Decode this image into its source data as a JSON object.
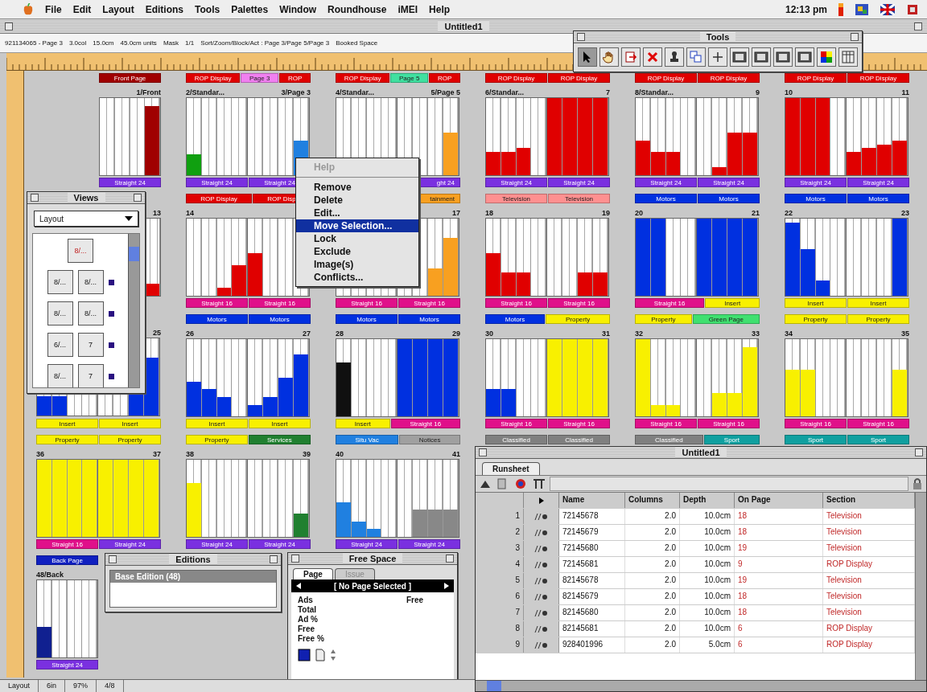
{
  "menubar": {
    "items": [
      "File",
      "Edit",
      "Layout",
      "Editions",
      "Tools",
      "Palettes",
      "Window",
      "Roundhouse",
      "iMEI",
      "Help"
    ],
    "clock": "12:13 pm"
  },
  "document": {
    "title": "Untitled1",
    "info": [
      "921134065 - Page 3",
      "3.0col",
      "15.0cm",
      "45.0cm units",
      "Mask",
      "1/1",
      "Sort/Zoom/Block/Act : Page 3/Page 5/Page 3",
      "Booked Space"
    ]
  },
  "tools": {
    "title": "Tools",
    "items": [
      {
        "kind": "pointer",
        "selected": true
      },
      {
        "kind": "hand",
        "selected": false
      },
      {
        "kind": "import",
        "selected": false
      },
      {
        "kind": "delete",
        "selected": false
      },
      {
        "kind": "stamp",
        "selected": false
      },
      {
        "kind": "columns",
        "selected": false
      },
      {
        "kind": "crosshair",
        "selected": false
      },
      {
        "kind": "panel",
        "selected": false
      },
      {
        "kind": "panel",
        "selected": false
      },
      {
        "kind": "panel",
        "selected": false
      },
      {
        "kind": "panel",
        "selected": false
      },
      {
        "kind": "palette",
        "selected": false
      },
      {
        "kind": "grid",
        "selected": false
      }
    ]
  },
  "rows": [
    {
      "spreads": [
        {
          "kind": "single_right",
          "section": [
            {
              "text": "Front Page",
              "color": "#a00000"
            }
          ],
          "right_label": "1/Front",
          "pages": [
            {
              "color": "#a00000",
              "cols": [
                {
                  "level": 0
                },
                {
                  "level": 0
                },
                {
                  "level": 0
                },
                {
                  "level": 0.9
                }
              ]
            }
          ],
          "template": [
            {
              "text": "Straight 24",
              "color": "#7a30e0"
            }
          ]
        },
        {
          "kind": "spread",
          "section": [
            {
              "text": "ROP Display",
              "color": "#e00000"
            },
            {
              "text": "Page 3",
              "color": "#f080f0"
            },
            {
              "text": "ROP",
              "color": "#e00000"
            }
          ],
          "left_label": "2/Standar...",
          "right_label": "3/Page 3",
          "pages": [
            {
              "color": "#10a010",
              "cols": [
                {
                  "level": 0.27
                },
                {
                  "level": 0
                },
                {
                  "level": 0
                },
                {
                  "level": 0
                }
              ]
            },
            {
              "color": "#2080e0",
              "cols": [
                {
                  "level": 0
                },
                {
                  "level": 0
                },
                {
                  "level": 0
                },
                {
                  "level": 0.45
                }
              ]
            }
          ],
          "template": [
            {
              "text": "Straight 24",
              "color": "#7a30e0"
            },
            {
              "text": "Straight 24",
              "color": "#7a30e0"
            }
          ]
        },
        {
          "kind": "spread",
          "section": [
            {
              "text": "ROP Display",
              "color": "#e00000"
            },
            {
              "text": "Page 5",
              "color": "#40e0a0"
            },
            {
              "text": "ROP",
              "color": "#e00000"
            }
          ],
          "left_label": "4/Standar...",
          "right_label": "5/Page 5",
          "pages": [
            {
              "cols": [
                {
                  "level": 0
                },
                {
                  "level": 0
                },
                {
                  "level": 0
                },
                {
                  "level": 0
                }
              ]
            },
            {
              "color": "#f8a020",
              "cols": [
                {
                  "level": 0
                },
                {
                  "level": 0
                },
                {
                  "level": 0
                },
                {
                  "level": 0.55
                }
              ]
            }
          ],
          "template": [
            {
              "text": "ght 24",
              "color": "#7a30e0"
            }
          ]
        },
        {
          "kind": "spread",
          "section": [
            {
              "text": "ROP Display",
              "color": "#e00000"
            },
            {
              "text": "ROP Display",
              "color": "#e00000"
            }
          ],
          "left_label": "6/Standar...",
          "right_label": "7",
          "pages": [
            {
              "color": "#e00000",
              "cols": [
                {
                  "level": 0.3
                },
                {
                  "level": 0.3
                },
                {
                  "level": 0.35
                },
                {
                  "level": 0
                }
              ]
            },
            {
              "color": "#e00000",
              "cols": [
                {
                  "level": 1
                },
                {
                  "level": 1
                },
                {
                  "level": 1
                },
                {
                  "level": 1
                }
              ]
            }
          ],
          "template": [
            {
              "text": "Straight 24",
              "color": "#7a30e0"
            },
            {
              "text": "Straight 24",
              "color": "#7a30e0"
            }
          ]
        },
        {
          "kind": "spread",
          "section": [
            {
              "text": "ROP Display",
              "color": "#e00000"
            },
            {
              "text": "ROP Display",
              "color": "#e00000"
            }
          ],
          "left_label": "8/Standar...",
          "right_label": "9",
          "pages": [
            {
              "color": "#e00000",
              "cols": [
                {
                  "level": 0.45
                },
                {
                  "level": 0.3
                },
                {
                  "level": 0.3
                },
                {
                  "level": 0
                }
              ]
            },
            {
              "color": "#e00000",
              "cols": [
                {
                  "level": 0
                },
                {
                  "level": 0.1
                },
                {
                  "level": 0.55
                },
                {
                  "level": 0.55
                }
              ]
            }
          ],
          "template": [
            {
              "text": "Straight 24",
              "color": "#7a30e0"
            },
            {
              "text": "Straight 24",
              "color": "#7a30e0"
            }
          ]
        },
        {
          "kind": "spread",
          "section": [
            {
              "text": "ROP Display",
              "color": "#e00000"
            },
            {
              "text": "ROP Display",
              "color": "#e00000"
            }
          ],
          "left_label": "10",
          "right_label": "11",
          "pages": [
            {
              "color": "#e00000",
              "cols": [
                {
                  "level": 1
                },
                {
                  "level": 1
                },
                {
                  "level": 1
                },
                {
                  "level": 0
                }
              ]
            },
            {
              "color": "#e00000",
              "cols": [
                {
                  "level": 0.3
                },
                {
                  "level": 0.35
                },
                {
                  "level": 0.4
                },
                {
                  "level": 0.45
                }
              ]
            }
          ],
          "template": [
            {
              "text": "Straight 24",
              "color": "#7a30e0"
            },
            {
              "text": "Straight 24",
              "color": "#7a30e0"
            }
          ]
        }
      ]
    },
    {
      "spreads": [
        {
          "kind": "single_right",
          "right_label": "13",
          "pages": [
            {
              "color": "#e00000",
              "cols": [
                {
                  "level": 0.15
                }
              ]
            }
          ]
        },
        {
          "kind": "spread",
          "section": [
            {
              "text": "ROP Display",
              "color": "#e00000"
            },
            {
              "text": "ROP Disp",
              "color": "#e00000"
            }
          ],
          "left_label": "14",
          "pages": [
            {
              "color": "#e00000",
              "cols": [
                {
                  "level": 0
                },
                {
                  "level": 0
                },
                {
                  "level": 0.1
                },
                {
                  "level": 0.4
                }
              ]
            },
            {
              "color": "#e00000",
              "cols": [
                {
                  "level": 0.55
                },
                {
                  "level": 0
                },
                {
                  "level": 0
                },
                {
                  "level": 0
                }
              ]
            }
          ],
          "template": [
            {
              "text": "Straight 16",
              "color": "#e0108a"
            },
            {
              "text": "Straight 16",
              "color": "#e0108a"
            }
          ]
        },
        {
          "kind": "spread",
          "section": [
            {
              "text": "tainment",
              "color": "#f8a020"
            }
          ],
          "right_label": "17",
          "pages": [
            {
              "cols": [
                {
                  "level": 0
                },
                {
                  "level": 0
                },
                {
                  "level": 0
                },
                {
                  "level": 0
                }
              ]
            },
            {
              "color": "#f8a020",
              "cols": [
                {
                  "level": 0
                },
                {
                  "level": 0
                },
                {
                  "level": 0.35
                },
                {
                  "level": 0.75
                }
              ]
            }
          ],
          "template": [
            {
              "text": "Straight 16",
              "color": "#e0108a"
            },
            {
              "text": "Straight 16",
              "color": "#e0108a"
            }
          ]
        },
        {
          "kind": "spread",
          "section": [
            {
              "text": "Television",
              "color": "#ff9090"
            },
            {
              "text": "Television",
              "color": "#ff9090"
            }
          ],
          "left_label": "18",
          "right_label": "19",
          "pages": [
            {
              "color": "#e00000",
              "cols": [
                {
                  "level": 0.55
                },
                {
                  "level": 0.3
                },
                {
                  "level": 0.3
                },
                {
                  "level": 0
                }
              ]
            },
            {
              "color": "#e00000",
              "cols": [
                {
                  "level": 0
                },
                {
                  "level": 0
                },
                {
                  "level": 0.3
                },
                {
                  "level": 0.3
                }
              ]
            }
          ],
          "template": [
            {
              "text": "Straight 16",
              "color": "#e0108a"
            },
            {
              "text": "Straight 16",
              "color": "#e0108a"
            }
          ]
        },
        {
          "kind": "spread",
          "section": [
            {
              "text": "Motors",
              "color": "#0030e0"
            },
            {
              "text": "Motors",
              "color": "#0030e0"
            }
          ],
          "left_label": "20",
          "right_label": "21",
          "pages": [
            {
              "color": "#0030e0",
              "cols": [
                {
                  "level": 1
                },
                {
                  "level": 1
                },
                {
                  "level": 0
                },
                {
                  "level": 0
                }
              ]
            },
            {
              "color": "#0030e0",
              "cols": [
                {
                  "level": 1
                },
                {
                  "level": 1
                },
                {
                  "level": 1
                },
                {
                  "level": 1
                }
              ]
            }
          ],
          "template": [
            {
              "text": "Straight 16",
              "color": "#e0108a"
            },
            {
              "text": "Insert",
              "color": "#f8f000"
            }
          ]
        },
        {
          "kind": "spread",
          "section": [
            {
              "text": "Motors",
              "color": "#0030e0"
            },
            {
              "text": "Motors",
              "color": "#0030e0"
            }
          ],
          "left_label": "22",
          "right_label": "23",
          "pages": [
            {
              "color": "#0030e0",
              "cols": [
                {
                  "level": 0.95
                },
                {
                  "level": 0.6
                },
                {
                  "level": 0.2
                },
                {
                  "level": 0
                }
              ]
            },
            {
              "color": "#0030e0",
              "cols": [
                {
                  "level": 0
                },
                {
                  "level": 0
                },
                {
                  "level": 0
                },
                {
                  "level": 1
                }
              ]
            }
          ],
          "template": [
            {
              "text": "Insert",
              "color": "#f8f000"
            },
            {
              "text": "Insert",
              "color": "#f8f000"
            }
          ]
        }
      ]
    },
    {
      "spreads": [
        {
          "kind": "spread",
          "right_label": "25",
          "pages": [
            {
              "color": "#0030e0",
              "cols": [
                {
                  "level": 0.25
                },
                {
                  "level": 0.25
                },
                {
                  "level": 0
                },
                {
                  "level": 0
                }
              ]
            },
            {
              "color": "#0030e0",
              "cols": [
                {
                  "level": 0
                },
                {
                  "level": 0
                },
                {
                  "level": 0.75
                },
                {
                  "level": 0.75
                }
              ]
            }
          ],
          "template": [
            {
              "text": "Insert",
              "color": "#f8f000"
            },
            {
              "text": "Insert",
              "color": "#f8f000"
            }
          ]
        },
        {
          "kind": "spread",
          "section": [
            {
              "text": "Motors",
              "color": "#0030e0"
            },
            {
              "text": "Motors",
              "color": "#0030e0"
            }
          ],
          "left_label": "26",
          "right_label": "27",
          "pages": [
            {
              "color": "#0030e0",
              "cols": [
                {
                  "level": 0.45
                },
                {
                  "level": 0.35
                },
                {
                  "level": 0.25
                },
                {
                  "level": 0
                }
              ]
            },
            {
              "color": "#0030e0",
              "cols": [
                {
                  "level": 0.15
                },
                {
                  "level": 0.25
                },
                {
                  "level": 0.5
                },
                {
                  "level": 0.8
                }
              ]
            }
          ],
          "template": [
            {
              "text": "Insert",
              "color": "#f8f000"
            },
            {
              "text": "Insert",
              "color": "#f8f000"
            }
          ]
        },
        {
          "kind": "spread",
          "section": [
            {
              "text": "Motors",
              "color": "#0030e0"
            },
            {
              "text": "Motors",
              "color": "#0030e0"
            }
          ],
          "left_label": "28",
          "right_label": "29",
          "pages": [
            {
              "color": "#101010",
              "cols": [
                {
                  "level": 0.7
                },
                {
                  "level": 0
                },
                {
                  "level": 0
                },
                {
                  "level": 0
                }
              ]
            },
            {
              "color": "#0030e0",
              "cols": [
                {
                  "level": 1
                },
                {
                  "level": 1
                },
                {
                  "level": 1
                },
                {
                  "level": 1
                }
              ]
            }
          ],
          "template": [
            {
              "text": "Insert",
              "color": "#f8f000"
            },
            {
              "text": "Straight 16",
              "color": "#e0108a"
            }
          ]
        },
        {
          "kind": "spread",
          "section": [
            {
              "text": "Motors",
              "color": "#0030e0"
            },
            {
              "text": "Property",
              "color": "#f8f000"
            }
          ],
          "left_label": "30",
          "right_label": "31",
          "pages": [
            {
              "color": "#0030e0",
              "cols": [
                {
                  "level": 0.35
                },
                {
                  "level": 0.35
                },
                {
                  "level": 0
                },
                {
                  "level": 0
                }
              ]
            },
            {
              "color": "#f8f000",
              "cols": [
                {
                  "level": 1
                },
                {
                  "level": 1
                },
                {
                  "level": 1
                },
                {
                  "level": 1
                }
              ]
            }
          ],
          "template": [
            {
              "text": "Straight 16",
              "color": "#e0108a"
            },
            {
              "text": "Straight 16",
              "color": "#e0108a"
            }
          ]
        },
        {
          "kind": "spread",
          "section": [
            {
              "text": "Property",
              "color": "#f8f000"
            },
            {
              "text": "Green Page",
              "color": "#40e070"
            }
          ],
          "left_label": "32",
          "right_label": "33",
          "pages": [
            {
              "color": "#f8f000",
              "cols": [
                {
                  "level": 1
                },
                {
                  "level": 0.15
                },
                {
                  "level": 0.15
                },
                {
                  "level": 0
                }
              ]
            },
            {
              "color": "#f8f000",
              "cols": [
                {
                  "level": 0
                },
                {
                  "level": 0.3
                },
                {
                  "level": 0.3
                },
                {
                  "level": 0.9
                }
              ]
            }
          ],
          "template": [
            {
              "text": "Straight 16",
              "color": "#e0108a"
            },
            {
              "text": "Straight 16",
              "color": "#e0108a"
            }
          ]
        },
        {
          "kind": "spread",
          "section": [
            {
              "text": "Property",
              "color": "#f8f000"
            },
            {
              "text": "Property",
              "color": "#f8f000"
            }
          ],
          "left_label": "34",
          "right_label": "35",
          "pages": [
            {
              "color": "#f8f000",
              "cols": [
                {
                  "level": 0.6
                },
                {
                  "level": 0.6
                },
                {
                  "level": 0
                },
                {
                  "level": 0
                }
              ]
            },
            {
              "color": "#f8f000",
              "cols": [
                {
                  "level": 0
                },
                {
                  "level": 0
                },
                {
                  "level": 0
                },
                {
                  "level": 0.6
                }
              ]
            }
          ],
          "template": [
            {
              "text": "Straight 16",
              "color": "#e0108a"
            },
            {
              "text": "Straight 16",
              "color": "#e0108a"
            }
          ]
        }
      ]
    },
    {
      "spreads": [
        {
          "kind": "spread",
          "section": [
            {
              "text": "Property",
              "color": "#f8f000"
            },
            {
              "text": "Property",
              "color": "#f8f000"
            }
          ],
          "left_label": "36",
          "right_label": "37",
          "pages": [
            {
              "color": "#f8f000",
              "cols": [
                {
                  "level": 1
                },
                {
                  "level": 1
                },
                {
                  "level": 1
                },
                {
                  "level": 1
                }
              ]
            },
            {
              "color": "#f8f000",
              "cols": [
                {
                  "level": 1
                },
                {
                  "level": 1
                },
                {
                  "level": 1
                },
                {
                  "level": 1
                }
              ]
            }
          ],
          "template": [
            {
              "text": "Straight 16",
              "color": "#e0108a"
            },
            {
              "text": "Straight 24",
              "color": "#7a30e0"
            }
          ]
        },
        {
          "kind": "spread",
          "section": [
            {
              "text": "Property",
              "color": "#f8f000"
            },
            {
              "text": "Services",
              "color": "#208030"
            }
          ],
          "left_label": "38",
          "right_label": "39",
          "pages": [
            {
              "color": "#f8f000",
              "cols": [
                {
                  "level": 0.7
                },
                {
                  "level": 0
                },
                {
                  "level": 0
                },
                {
                  "level": 0
                }
              ]
            },
            {
              "color": "#208030",
              "cols": [
                {
                  "level": 0
                },
                {
                  "level": 0
                },
                {
                  "level": 0
                },
                {
                  "level": 0.3
                }
              ]
            }
          ],
          "template": [
            {
              "text": "Straight 24",
              "color": "#7a30e0"
            },
            {
              "text": "Straight 24",
              "color": "#7a30e0"
            }
          ]
        },
        {
          "kind": "spread",
          "section": [
            {
              "text": "Situ Vac",
              "color": "#2080e0"
            },
            {
              "text": "Notices",
              "color": "#a0a0a0"
            }
          ],
          "left_label": "40",
          "right_label": "41",
          "pages": [
            {
              "color": "#2080e0",
              "cols": [
                {
                  "level": 0.45
                },
                {
                  "level": 0.2
                },
                {
                  "level": 0.1
                },
                {
                  "level": 0
                }
              ]
            },
            {
              "color": "#888888",
              "cols": [
                {
                  "level": 0
                },
                {
                  "level": 0.35
                },
                {
                  "level": 0.35
                },
                {
                  "level": 0.35
                }
              ]
            }
          ],
          "template": [
            {
              "text": "Straight 24",
              "color": "#7a30e0"
            },
            {
              "text": "Straight 24",
              "color": "#7a30e0"
            }
          ]
        },
        {
          "kind": "spread",
          "section": [
            {
              "text": "Classified",
              "color": "#808080"
            },
            {
              "text": "Classified",
              "color": "#808080"
            }
          ]
        },
        {
          "kind": "spread",
          "section": [
            {
              "text": "Classified",
              "color": "#808080"
            },
            {
              "text": "Sport",
              "color": "#10a0a0"
            }
          ]
        },
        {
          "kind": "spread",
          "section": [
            {
              "text": "Sport",
              "color": "#10a0a0"
            },
            {
              "text": "Sport",
              "color": "#10a0a0"
            }
          ]
        }
      ]
    },
    {
      "spreads": [
        {
          "kind": "single_left",
          "section": [
            {
              "text": "Back Page",
              "color": "#1020c0"
            }
          ],
          "left_label": "48/Back",
          "pages": [
            {
              "color": "#102090",
              "cols": [
                {
                  "level": 0.4
                },
                {
                  "level": 0
                },
                {
                  "level": 0
                },
                {
                  "level": 0
                }
              ]
            }
          ],
          "template": [
            {
              "text": "Straight 24",
              "color": "#7a30e0"
            }
          ]
        }
      ]
    }
  ],
  "context_menu": {
    "items": [
      {
        "kind": "item",
        "label": "Help",
        "disabled": true,
        "selected": false
      },
      {
        "kind": "separator"
      },
      {
        "kind": "item",
        "label": "Remove",
        "disabled": false,
        "selected": false
      },
      {
        "kind": "item",
        "label": "Delete",
        "disabled": false,
        "selected": false
      },
      {
        "kind": "item",
        "label": "Edit...",
        "disabled": false,
        "selected": false
      },
      {
        "kind": "item",
        "label": "Move Selection...",
        "disabled": false,
        "selected": true
      },
      {
        "kind": "item",
        "label": "Lock",
        "disabled": false,
        "selected": false
      },
      {
        "kind": "item",
        "label": "Exclude",
        "disabled": false,
        "selected": false
      },
      {
        "kind": "item",
        "label": "Image(s)",
        "disabled": false,
        "selected": false
      },
      {
        "kind": "item",
        "label": "Conflicts...",
        "disabled": false,
        "selected": false
      }
    ]
  },
  "views": {
    "title": "Views",
    "view": "Layout",
    "items": [
      {
        "pages": [
          "8/..."
        ]
      },
      {
        "pages": [
          "8/...",
          "8/..."
        ]
      },
      {
        "pages": [
          "8/...",
          "8/..."
        ]
      },
      {
        "pages": [
          "6/...",
          "7"
        ]
      },
      {
        "pages": [
          "8/...",
          "7"
        ]
      }
    ]
  },
  "editions": {
    "title": "Editions",
    "items": [
      {
        "label": "Base Edition (48)",
        "selected": true
      }
    ]
  },
  "free_space": {
    "title": "Free Space",
    "tabs": [
      {
        "label": "Page",
        "selected": true
      },
      {
        "label": "Issue",
        "selected": false
      }
    ],
    "nav": "[ No Page Selected ]",
    "header": [
      "Ads",
      "Free"
    ],
    "rows": [
      "Total",
      "Ad %",
      "Free",
      "Free %"
    ]
  },
  "runsheet": {
    "title": "Untitled1",
    "tabs": [
      {
        "label": "Runsheet",
        "selected": true
      }
    ],
    "columns": [
      "Name",
      "Columns",
      "Depth",
      "On Page",
      "Section"
    ],
    "rows": [
      {
        "index": "1",
        "name": "72145678",
        "columns": "2.0",
        "depth": "10.0cm",
        "on_page": "18",
        "section": "Television"
      },
      {
        "index": "2",
        "name": "72145679",
        "columns": "2.0",
        "depth": "10.0cm",
        "on_page": "18",
        "section": "Television"
      },
      {
        "index": "3",
        "name": "72145680",
        "columns": "2.0",
        "depth": "10.0cm",
        "on_page": "19",
        "section": "Television"
      },
      {
        "index": "4",
        "name": "72145681",
        "columns": "2.0",
        "depth": "10.0cm",
        "on_page": "9",
        "section": "ROP Display"
      },
      {
        "index": "5",
        "name": "82145678",
        "columns": "2.0",
        "depth": "10.0cm",
        "on_page": "19",
        "section": "Television"
      },
      {
        "index": "6",
        "name": "82145679",
        "columns": "2.0",
        "depth": "10.0cm",
        "on_page": "18",
        "section": "Television"
      },
      {
        "index": "7",
        "name": "82145680",
        "columns": "2.0",
        "depth": "10.0cm",
        "on_page": "18",
        "section": "Television"
      },
      {
        "index": "8",
        "name": "82145681",
        "columns": "2.0",
        "depth": "10.0cm",
        "on_page": "6",
        "section": "ROP Display"
      },
      {
        "index": "9",
        "name": "928401996",
        "columns": "2.0",
        "depth": "5.0cm",
        "on_page": "6",
        "section": "ROP Display"
      }
    ]
  },
  "status_bar": {
    "items": [
      "Layout",
      "6in",
      "97%",
      "4/8"
    ]
  }
}
